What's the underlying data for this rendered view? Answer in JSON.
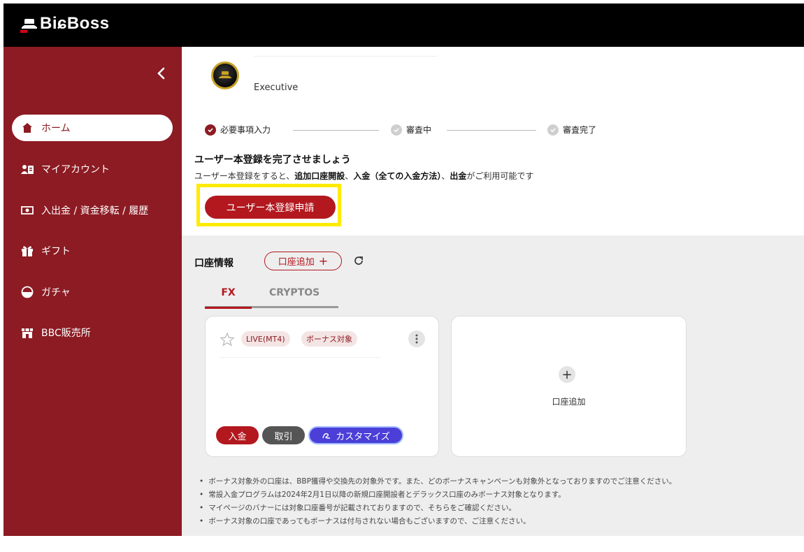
{
  "header": {
    "logo_text": "BiɕBoss"
  },
  "sidebar": {
    "items": [
      {
        "label": "ホーム",
        "icon": "home-icon",
        "active": true
      },
      {
        "label": "マイアカウント",
        "icon": "account-icon",
        "active": false
      },
      {
        "label": "入出金 / 資金移転 / 履歴",
        "icon": "money-icon",
        "active": false
      },
      {
        "label": "ギフト",
        "icon": "gift-icon",
        "active": false
      },
      {
        "label": "ガチャ",
        "icon": "gacha-icon",
        "active": false
      },
      {
        "label": "BBC販売所",
        "icon": "shop-icon",
        "active": false
      }
    ]
  },
  "rank": {
    "label": "Executive"
  },
  "stepper": {
    "steps": [
      {
        "label": "必要事項入力",
        "done": true
      },
      {
        "label": "審査中",
        "done": false
      },
      {
        "label": "審査完了",
        "done": false
      }
    ]
  },
  "registration": {
    "title": "ユーザー本登録を完了させましょう",
    "desc_parts": [
      "ユーザー本登録をすると、",
      "追加口座開設",
      "、",
      "入金（全ての入金方法）",
      "、",
      "出金",
      "がご利用可能です"
    ],
    "button_label": "ユーザー本登録申請"
  },
  "accounts": {
    "title": "口座情報",
    "add_pill_label": "口座追加",
    "add_pill_plus": "+",
    "tabs": [
      "FX",
      "CRYPTOS"
    ],
    "card": {
      "tags": [
        "LIVE(MT4)",
        "ボーナス対象"
      ],
      "buttons": {
        "deposit": "入金",
        "trade": "取引",
        "customize": "カスタマイズ"
      }
    },
    "add_card": {
      "plus": "+",
      "label": "口座追加"
    }
  },
  "notes": [
    "ボーナス対象外の口座は、BBP獲得や交換先の対象外です。また、どのボーナスキャンペーンも対象外となっておりますのでご注意ください。",
    "常設入金プログラムは2024年2月1日以降の新規口座開設者とデラックス口座のみボーナス対象となります。",
    "マイページのバナーには対象口座番号が記載されておりますので、そちらをご確認ください。",
    "ボーナス対象の口座であってもボーナスは付与されない場合もございますので、ご注意ください。"
  ],
  "colors": {
    "brand_red": "#8c1b23",
    "button_red": "#b3181f",
    "highlight": "#ffeb00",
    "customize_blue": "#4b3fd8"
  }
}
